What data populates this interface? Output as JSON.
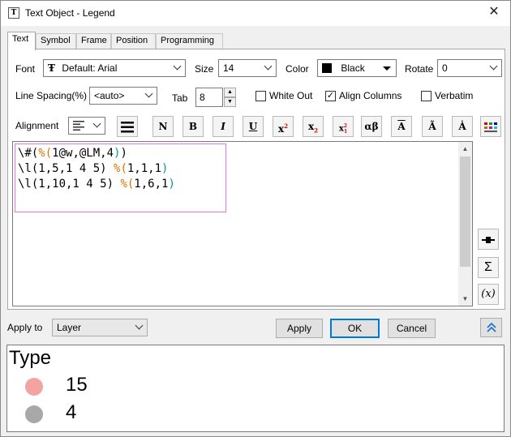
{
  "window": {
    "title": "Text Object - Legend",
    "close_glyph": "✕"
  },
  "tabs": [
    {
      "label": "Text"
    },
    {
      "label": "Symbol"
    },
    {
      "label": "Frame"
    },
    {
      "label": "Position"
    },
    {
      "label": "Programming"
    }
  ],
  "font": {
    "label": "Font",
    "value": "Default: Arial",
    "icon": "truetype-icon"
  },
  "size": {
    "label": "Size",
    "value": "14"
  },
  "color": {
    "label": "Color",
    "value": "Black",
    "swatch": "#000000"
  },
  "rotate": {
    "label": "Rotate",
    "value": "0"
  },
  "line_spacing": {
    "label": "Line Spacing(%)",
    "value": "<auto>"
  },
  "tab_width": {
    "label": "Tab",
    "value": "8"
  },
  "white_out": {
    "label": "White Out",
    "checked": false
  },
  "align_columns": {
    "label": "Align Columns",
    "checked": true
  },
  "verbatim": {
    "label": "Verbatim",
    "checked": false
  },
  "alignment": {
    "label": "Alignment"
  },
  "format_buttons": {
    "normal": "N",
    "bold": "B",
    "italic": "I",
    "underline": "U",
    "greek": "αβ",
    "overbar": "A",
    "tilde": "Ã",
    "dot": "Ȧ"
  },
  "editor": {
    "lines": [
      [
        {
          "t": "\\#(",
          "c": "k"
        },
        {
          "t": "%(",
          "c": "o"
        },
        {
          "t": "1@w,@LM,4",
          "c": "k"
        },
        {
          "t": ")",
          "c": "t"
        },
        {
          "t": ")",
          "c": "k"
        }
      ],
      [
        {
          "t": "\\l(1,5,1 4 5) ",
          "c": "k"
        },
        {
          "t": "%(",
          "c": "o"
        },
        {
          "t": "1,1,1",
          "c": "k"
        },
        {
          "t": ")",
          "c": "t"
        }
      ],
      [
        {
          "t": "\\l(1,10,1 4 5) ",
          "c": "k"
        },
        {
          "t": "%(",
          "c": "o"
        },
        {
          "t": "1,6,1",
          "c": "k"
        },
        {
          "t": ")",
          "c": "t"
        }
      ]
    ],
    "colors": {
      "k": "#000000",
      "o": "#e07000",
      "t": "#009a9a"
    },
    "selection_color": "#e57ae5"
  },
  "side_buttons": {
    "sigma": "Σ",
    "fx": "(x)"
  },
  "apply_to": {
    "label": "Apply to",
    "value": "Layer"
  },
  "buttons": {
    "apply": "Apply",
    "ok": "OK",
    "cancel": "Cancel",
    "expand": "⌃⌃"
  },
  "preview": {
    "title": "Type",
    "entries": [
      {
        "value": "15",
        "color": "#f4a3a3"
      },
      {
        "value": "4",
        "color": "#a8a8a8"
      }
    ]
  }
}
